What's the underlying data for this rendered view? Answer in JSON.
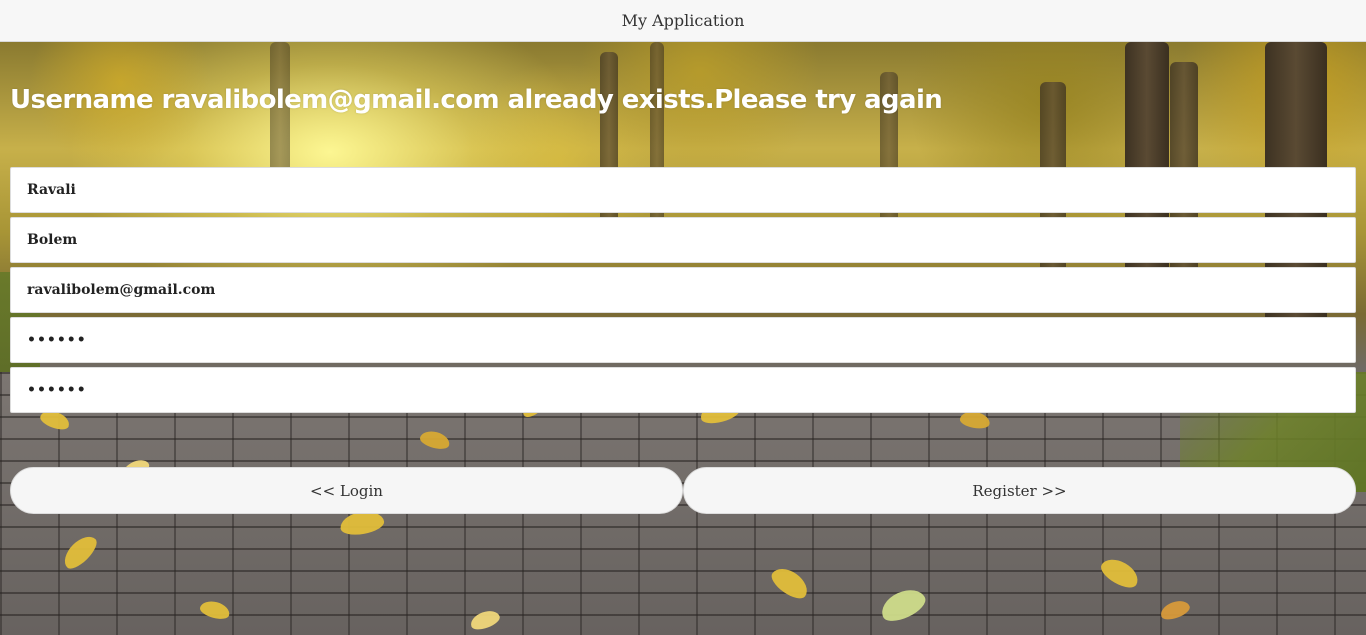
{
  "header": {
    "title": "My Application"
  },
  "error": {
    "message": "Username ravalibolem@gmail.com already exists.Please try again"
  },
  "form": {
    "first_name": "Ravali",
    "last_name": "Bolem",
    "email": "ravalibolem@gmail.com",
    "password": "••••••",
    "confirm_password": "••••••"
  },
  "buttons": {
    "login": "<< Login",
    "register": "Register >>"
  },
  "colors": {
    "header_bg": "#f7f7f7",
    "button_bg": "#f6f6f6",
    "error_text": "#ffffff"
  }
}
